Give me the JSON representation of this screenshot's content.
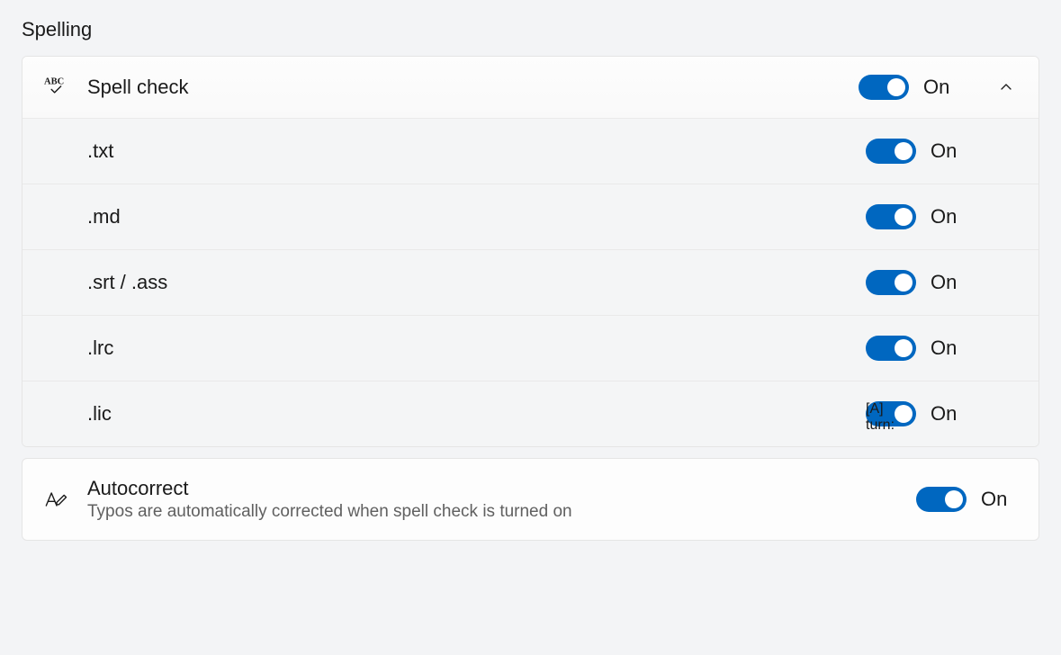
{
  "section": {
    "title": "Spelling"
  },
  "spellcheck": {
    "title": "Spell check",
    "state_label": "On",
    "items": [
      {
        "label": ".txt",
        "state_label": "On"
      },
      {
        "label": ".md",
        "state_label": "On"
      },
      {
        "label": ".srt / .ass",
        "state_label": "On"
      },
      {
        "label": ".lrc",
        "state_label": "On"
      },
      {
        "label": ".lic",
        "state_label": "On"
      }
    ]
  },
  "autocorrect": {
    "title": "Autocorrect",
    "description": "Typos are automatically corrected when spell check is turned on",
    "state_label": "On"
  },
  "colors": {
    "accent": "#0067c0"
  }
}
